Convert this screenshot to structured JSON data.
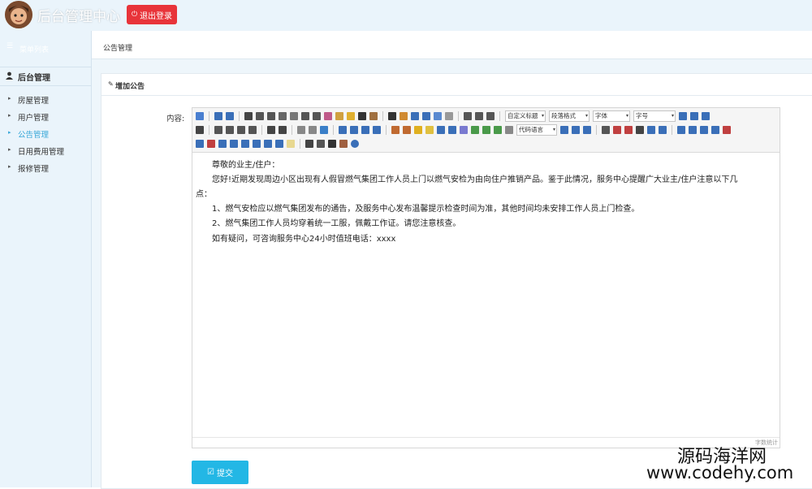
{
  "header": {
    "title": "后台管理中心",
    "logout_label": "退出登录",
    "logout_icon": "power-icon",
    "brand_color": "#e8343a",
    "bg_color": "#eaf4fb"
  },
  "sidebar": {
    "top_label": "菜单列表",
    "section_label": "后台管理",
    "section_icon": "user-icon",
    "items": [
      {
        "label": "房屋管理",
        "active": false
      },
      {
        "label": "用户管理",
        "active": false
      },
      {
        "label": "公告管理",
        "active": true
      },
      {
        "label": "日用费用管理",
        "active": false
      },
      {
        "label": "报修管理",
        "active": false
      }
    ],
    "active_color": "#3aa8d8"
  },
  "breadcrumb": "公告管理",
  "panel": {
    "title": "增加公告",
    "title_icon": "edit-icon"
  },
  "form": {
    "content_label": "内容:",
    "submit_label": "提交",
    "submit_icon": "check-square-icon",
    "submit_color": "#23b7e5"
  },
  "editor": {
    "toolbar": {
      "combo_custom_title": "自定义标题",
      "combo_paragraph": "段落格式",
      "combo_font": "字体",
      "combo_size": "字号",
      "combo_code_lang": "代码语言"
    },
    "content": [
      "尊敬的业主/住户：",
      "您好!近期发现周边小区出现有人假冒燃气集团工作人员上门以燃气安检为由向住户推销产品。鉴于此情况，服务中心提醒广大业主/住户注意以下几",
      "点：",
      "1、燃气安检应以燃气集团发布的通告，及服务中心发布温馨提示检查时间为准，其他时间均未安排工作人员上门检查。",
      "2、燃气集团工作人员均穿着统一工服，佩戴工作证。请您注意核查。",
      "如有疑问，可咨询服务中心24小时值班电话：xxxx"
    ],
    "word_count_label": "字数统计"
  },
  "watermark": {
    "line1": "源码海洋网",
    "line2": "www.codehy.com"
  }
}
